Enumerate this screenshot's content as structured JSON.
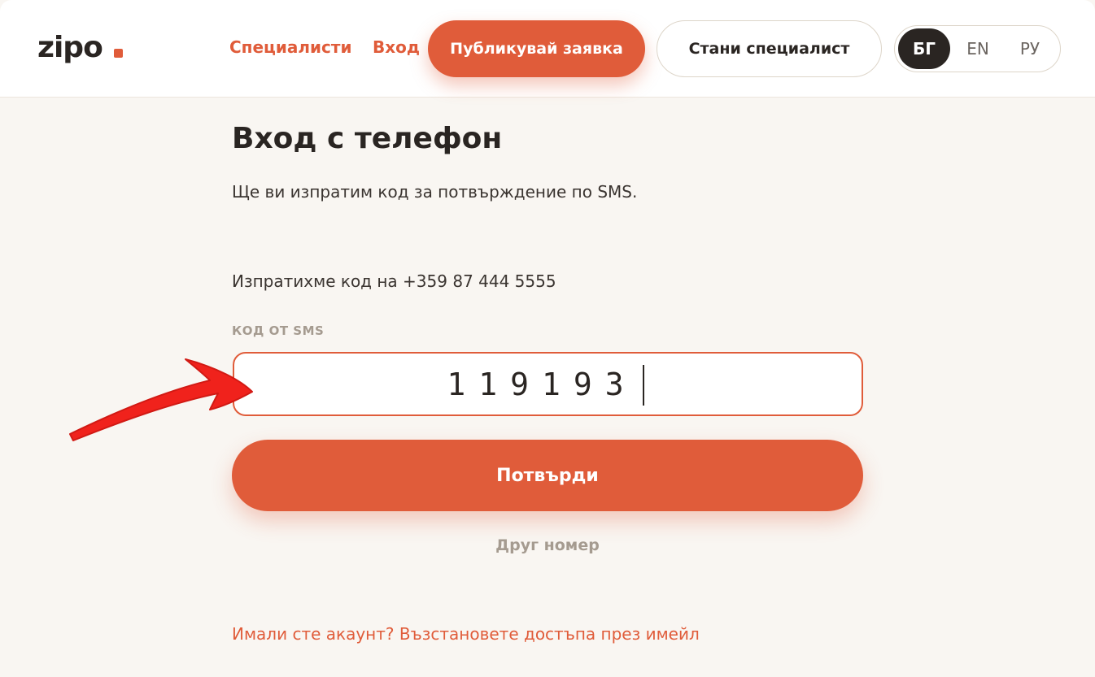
{
  "header": {
    "logo_text": "zipo",
    "nav": {
      "specialists": "Специалисти",
      "login": "Вход"
    },
    "publish_button": "Публикувай заявка",
    "become_button": "Стани специалист",
    "languages": [
      "БГ",
      "EN",
      "РУ"
    ],
    "active_language": "БГ"
  },
  "main": {
    "title": "Вход с телефон",
    "subtitle": "Ще ви изпратим код за потвърждение по SMS.",
    "sent_info": "Изпратихме код на +359 87 444 5555",
    "code_label": "КОД ОТ SMS",
    "code_value": "119193",
    "confirm_button": "Потвърди",
    "other_number": "Друг номер",
    "recover_link": "Имали сте акаунт? Възстановете достъпа през имейл"
  },
  "colors": {
    "accent": "#e05c3a",
    "background": "#f9f6f2",
    "dark": "#2a2522",
    "muted": "#a59b90",
    "annotation_arrow": "#f0221c"
  },
  "annotation": {
    "icon": "red-arrow-icon"
  }
}
